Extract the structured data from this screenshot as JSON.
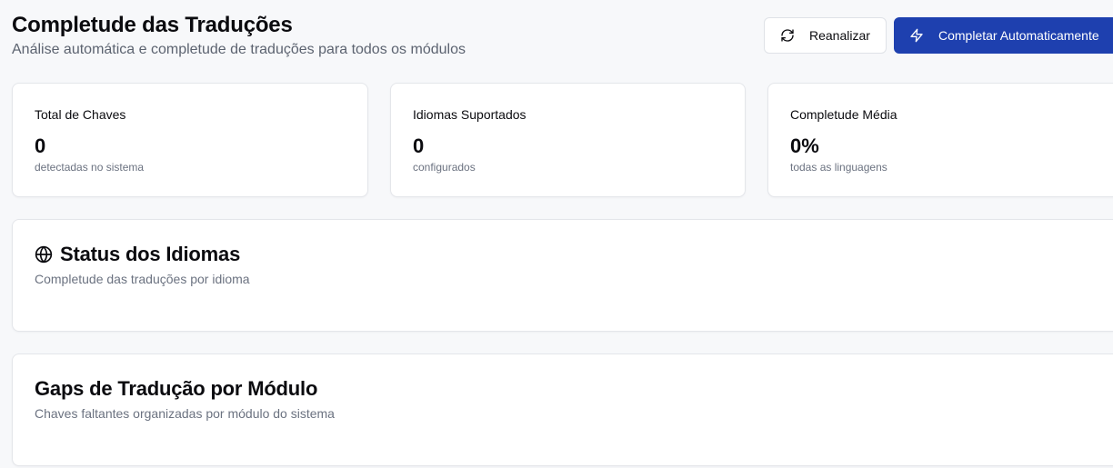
{
  "header": {
    "title": "Completude das Traduções",
    "subtitle": "Análise automática e completude de traduções para todos os módulos"
  },
  "actions": {
    "reanalyze_label": "Reanalizar",
    "reanalyze_icon": "refresh-icon",
    "autocomplete_label": "Completar Automaticamente",
    "autocomplete_icon": "lightning-icon",
    "primary_color": "#1e40af"
  },
  "stats": [
    {
      "label": "Total de Chaves",
      "value": "0",
      "sub": "detectadas no sistema"
    },
    {
      "label": "Idiomas Suportados",
      "value": "0",
      "sub": "configurados"
    },
    {
      "label": "Completude Média",
      "value": "0%",
      "sub": "todas as linguagens"
    }
  ],
  "sections": {
    "languages": {
      "icon": "globe-icon",
      "title": "Status dos Idiomas",
      "subtitle": "Completude das traduções por idioma"
    },
    "gaps": {
      "title": "Gaps de Tradução por Módulo",
      "subtitle": "Chaves faltantes organizadas por módulo do sistema"
    }
  }
}
